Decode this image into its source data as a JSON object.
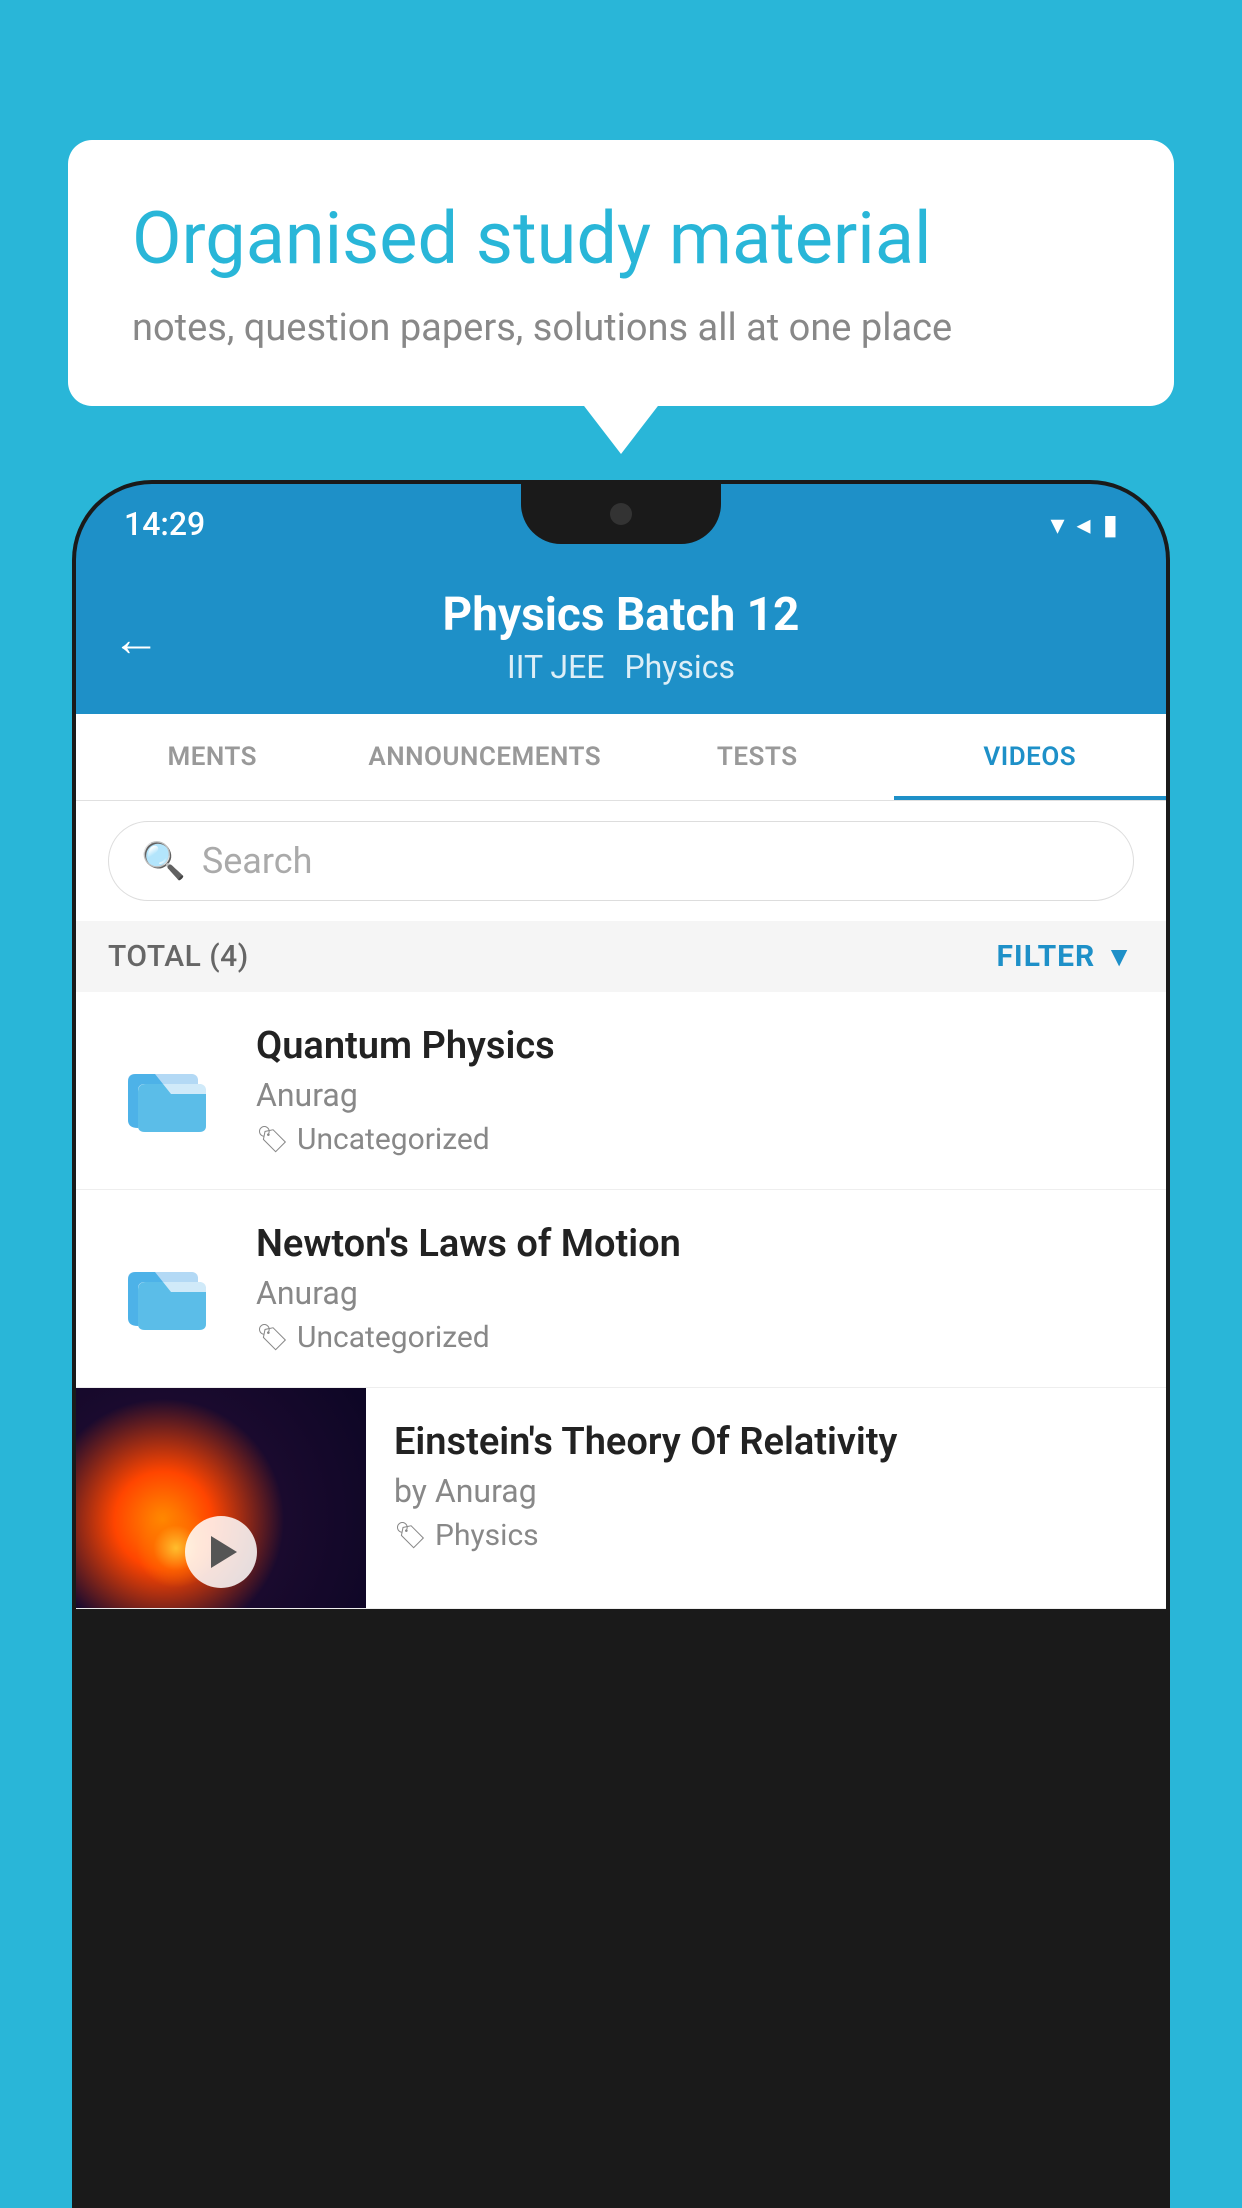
{
  "background_color": "#29b6d8",
  "bubble": {
    "title": "Organised study material",
    "subtitle": "notes, question papers, solutions all at one place"
  },
  "phone": {
    "status_bar": {
      "time": "14:29"
    },
    "header": {
      "title": "Physics Batch 12",
      "subtitle_tags": [
        "IIT JEE",
        "Physics"
      ],
      "back_label": "←"
    },
    "tabs": [
      {
        "label": "MENTS",
        "active": false
      },
      {
        "label": "ANNOUNCEMENTS",
        "active": false
      },
      {
        "label": "TESTS",
        "active": false
      },
      {
        "label": "VIDEOS",
        "active": true
      }
    ],
    "search": {
      "placeholder": "Search"
    },
    "filter_bar": {
      "total_label": "TOTAL (4)",
      "filter_label": "FILTER"
    },
    "videos": [
      {
        "id": 1,
        "title": "Quantum Physics",
        "author": "Anurag",
        "tag": "Uncategorized",
        "has_thumbnail": false
      },
      {
        "id": 2,
        "title": "Newton's Laws of Motion",
        "author": "Anurag",
        "tag": "Uncategorized",
        "has_thumbnail": false
      },
      {
        "id": 3,
        "title": "Einstein's Theory Of Relativity",
        "author": "by Anurag",
        "tag": "Physics",
        "has_thumbnail": true
      }
    ]
  }
}
